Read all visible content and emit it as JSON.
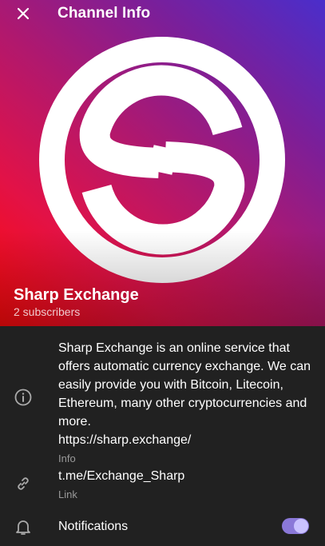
{
  "header": {
    "title": "Channel Info",
    "close_icon": "close-icon"
  },
  "channel": {
    "name": "Sharp Exchange",
    "subscribers": "2 subscribers",
    "logo_icon": "sharp-exchange-logo"
  },
  "info": {
    "description": "Sharp Exchange is an online service that offers automatic currency exchange. We can easily provide you with Bitcoin, Litecoin, Ethereum, many other cryptocurrencies and more.",
    "website": "https://sharp.exchange/",
    "label": "Info",
    "icon": "info-icon"
  },
  "link": {
    "value": "t.me/Exchange_Sharp",
    "label": "Link",
    "icon": "link-icon"
  },
  "notifications": {
    "label": "Notifications",
    "enabled": true,
    "icon": "bell-icon"
  },
  "colors": {
    "accent": "#8a78d8",
    "background": "#212121",
    "secondary_text": "#9a9a9a"
  }
}
